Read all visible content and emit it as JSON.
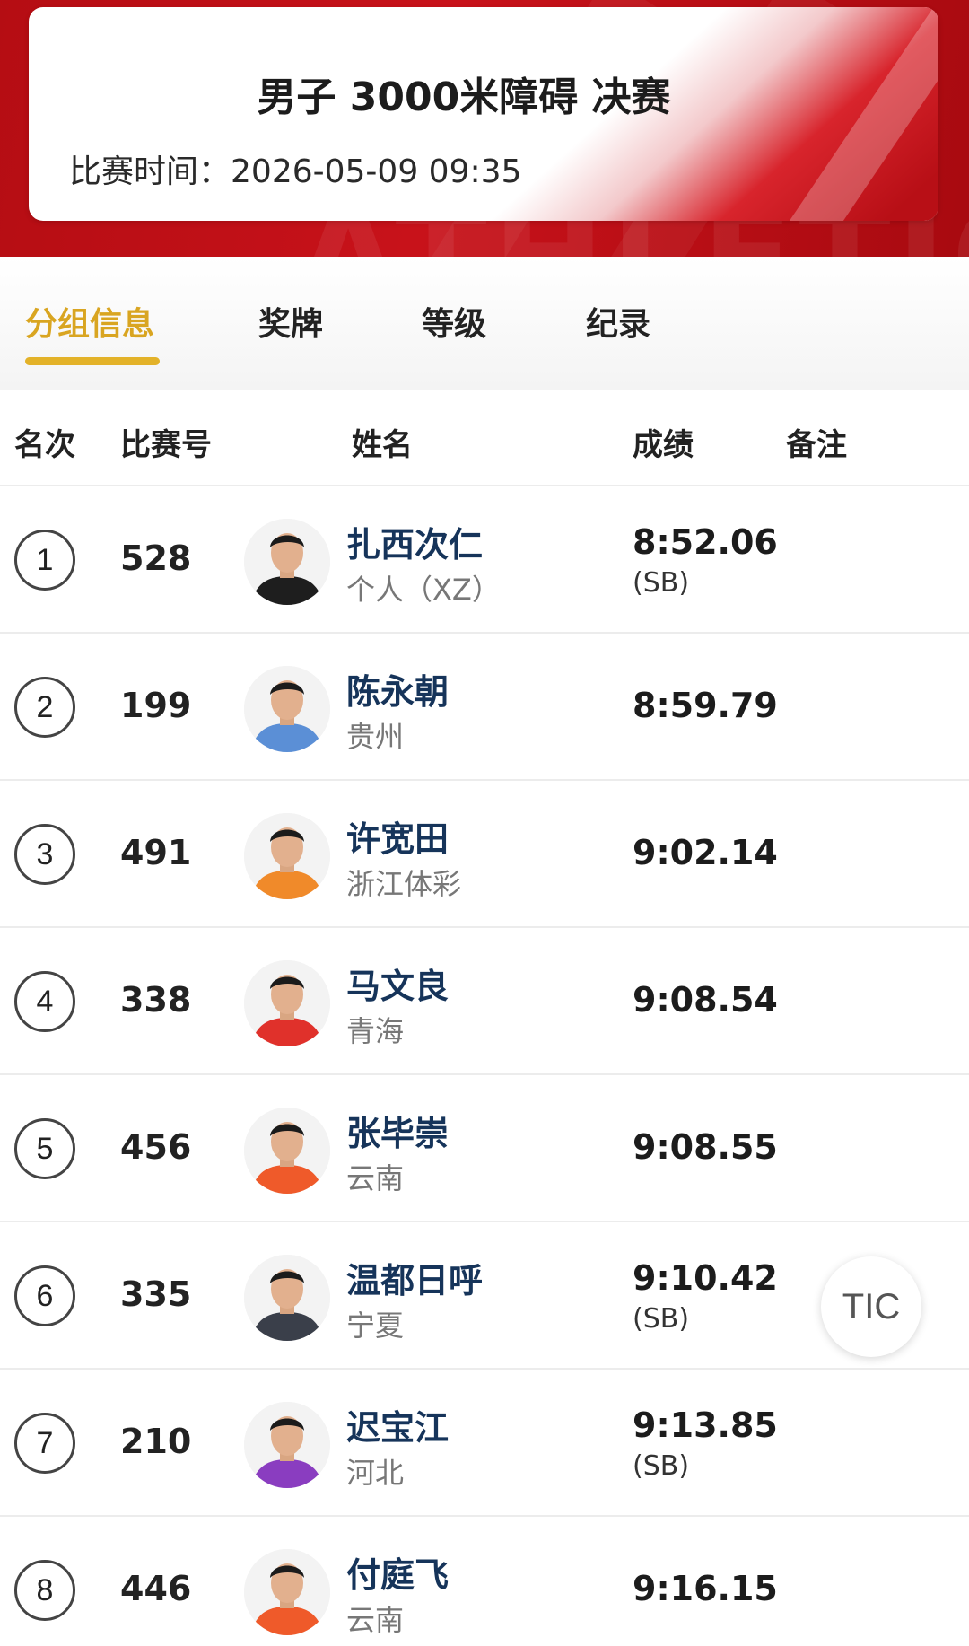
{
  "header": {
    "title": "男子 3000米障碍 决赛",
    "time_label": "比赛时间：",
    "time_value": "2026-05-09  09:35"
  },
  "tabs": [
    {
      "label": "分组信息",
      "active": true
    },
    {
      "label": "奖牌",
      "active": false
    },
    {
      "label": "等级",
      "active": false
    },
    {
      "label": "纪录",
      "active": false
    }
  ],
  "columns": {
    "rank": "名次",
    "bib": "比赛号",
    "name": "姓名",
    "score": "成绩",
    "remark": "备注"
  },
  "rows": [
    {
      "rank": "1",
      "bib": "528",
      "name": "扎西次仁",
      "team": "个人（XZ）",
      "score": "8:52.06",
      "note": "(SB)",
      "kit_color": "#1e1e1e"
    },
    {
      "rank": "2",
      "bib": "199",
      "name": "陈永朝",
      "team": "贵州",
      "score": "8:59.79",
      "note": "",
      "kit_color": "#5b8fd6"
    },
    {
      "rank": "3",
      "bib": "491",
      "name": "许宽田",
      "team": "浙江体彩",
      "score": "9:02.14",
      "note": "",
      "kit_color": "#f08a2a"
    },
    {
      "rank": "4",
      "bib": "338",
      "name": "马文良",
      "team": "青海",
      "score": "9:08.54",
      "note": "",
      "kit_color": "#e0312b"
    },
    {
      "rank": "5",
      "bib": "456",
      "name": "张毕崇",
      "team": "云南",
      "score": "9:08.55",
      "note": "",
      "kit_color": "#ef5a2a"
    },
    {
      "rank": "6",
      "bib": "335",
      "name": "温都日呼",
      "team": "宁夏",
      "score": "9:10.42",
      "note": "(SB)",
      "kit_color": "#3a3f4a"
    },
    {
      "rank": "7",
      "bib": "210",
      "name": "迟宝江",
      "team": "河北",
      "score": "9:13.85",
      "note": "(SB)",
      "kit_color": "#8a3dc0"
    },
    {
      "rank": "8",
      "bib": "446",
      "name": "付庭飞",
      "team": "云南",
      "score": "9:16.15",
      "note": "",
      "kit_color": "#ef5a2a"
    }
  ],
  "floating_button": {
    "label": "TIC"
  },
  "colors": {
    "banner_red": "#c8121a",
    "active_tab": "#d9a521",
    "name_text": "#16345a"
  }
}
